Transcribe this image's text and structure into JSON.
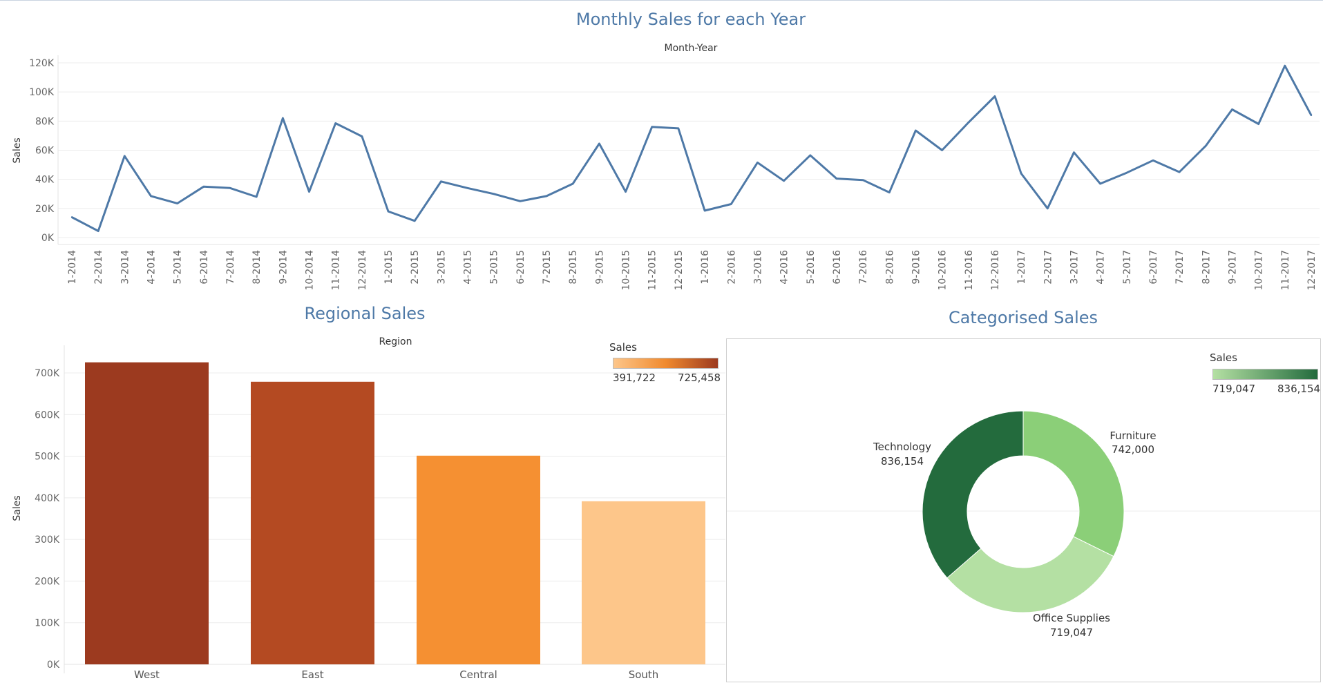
{
  "titles": {
    "monthly": "Monthly Sales for each Year",
    "regional": "Regional Sales",
    "categorised": "Categorised Sales"
  },
  "chart_data": [
    {
      "type": "line",
      "title": "Monthly Sales for each Year",
      "subtitle": "Month-Year",
      "ylabel": "Sales",
      "ylim": [
        0,
        120000
      ],
      "yticks": [
        "0K",
        "20K",
        "40K",
        "60K",
        "80K",
        "100K",
        "120K"
      ],
      "color": "#4e79a7",
      "x": [
        "1-2014",
        "2-2014",
        "3-2014",
        "4-2014",
        "5-2014",
        "6-2014",
        "7-2014",
        "8-2014",
        "9-2014",
        "10-2014",
        "11-2014",
        "12-2014",
        "1-2015",
        "2-2015",
        "3-2015",
        "4-2015",
        "5-2015",
        "6-2015",
        "7-2015",
        "8-2015",
        "9-2015",
        "10-2015",
        "11-2015",
        "12-2015",
        "1-2016",
        "2-2016",
        "3-2016",
        "4-2016",
        "5-2016",
        "6-2016",
        "7-2016",
        "8-2016",
        "9-2016",
        "10-2016",
        "11-2016",
        "12-2016",
        "1-2017",
        "2-2017",
        "3-2017",
        "4-2017",
        "5-2017",
        "6-2017",
        "7-2017",
        "8-2017",
        "9-2017",
        "10-2017",
        "11-2017",
        "12-2017"
      ],
      "values": [
        14000,
        4500,
        56000,
        28500,
        23500,
        35000,
        34000,
        28000,
        82000,
        31500,
        78500,
        69500,
        18000,
        11500,
        38500,
        34000,
        30000,
        25000,
        28500,
        37000,
        64500,
        31500,
        76000,
        75000,
        18500,
        23000,
        51500,
        39000,
        56500,
        40500,
        39500,
        31000,
        73500,
        60000,
        79000,
        97000,
        44000,
        20000,
        58500,
        37000,
        44500,
        53000,
        45000,
        63000,
        88000,
        78000,
        118000,
        84000
      ],
      "grid": true
    },
    {
      "type": "bar",
      "title": "Regional Sales",
      "subtitle": "Region",
      "ylabel": "Sales",
      "ylim": [
        0,
        700000
      ],
      "yticks": [
        "0K",
        "100K",
        "200K",
        "300K",
        "400K",
        "500K",
        "600K",
        "700K"
      ],
      "categories": [
        "West",
        "East",
        "Central",
        "South"
      ],
      "values": [
        725458,
        678781,
        501240,
        391722
      ],
      "colors": [
        "#9c3a1f",
        "#b44a22",
        "#f59032",
        "#fdc68a"
      ],
      "legend": {
        "title": "Sales",
        "min": "391,722",
        "max": "725,458",
        "colors": [
          "#fdc68a",
          "#f08a2e",
          "#9c3a1f"
        ],
        "placement": "top-right"
      }
    },
    {
      "type": "pie",
      "title": "Categorised Sales",
      "donut": true,
      "categories": [
        "Furniture",
        "Office Supplies",
        "Technology"
      ],
      "values": [
        742000,
        719047,
        836154
      ],
      "value_labels": [
        "742,000",
        "719,047",
        "836,154"
      ],
      "colors": [
        "#8bcf78",
        "#b4e0a3",
        "#236b3d"
      ],
      "legend": {
        "title": "Sales",
        "min": "719,047",
        "max": "836,154",
        "colors": [
          "#b4e0a3",
          "#236b3d"
        ],
        "placement": "top-right"
      }
    }
  ]
}
